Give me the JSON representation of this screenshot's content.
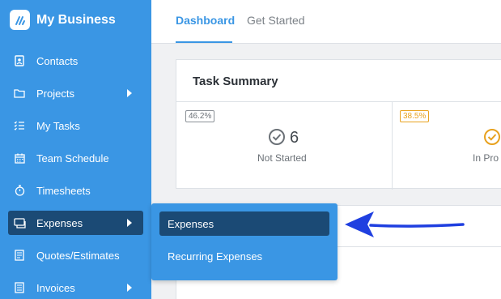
{
  "app": {
    "name": "My Business"
  },
  "sidebar": {
    "items": [
      {
        "label": "Contacts",
        "icon": "contacts-icon"
      },
      {
        "label": "Projects",
        "icon": "folder-icon",
        "has_submenu": true
      },
      {
        "label": "My Tasks",
        "icon": "tasks-icon"
      },
      {
        "label": "Team Schedule",
        "icon": "calendar-icon"
      },
      {
        "label": "Timesheets",
        "icon": "stopwatch-icon"
      },
      {
        "label": "Expenses",
        "icon": "expenses-icon",
        "has_submenu": true,
        "active": true
      },
      {
        "label": "Quotes/Estimates",
        "icon": "quotes-icon"
      },
      {
        "label": "Invoices",
        "icon": "invoice-icon",
        "has_submenu": true
      }
    ]
  },
  "header": {
    "tabs": [
      {
        "label": "Dashboard",
        "active": true
      },
      {
        "label": "Get Started",
        "active": false
      }
    ]
  },
  "task_summary": {
    "title": "Task Summary",
    "stats": [
      {
        "percent": "46.2%",
        "count": "6",
        "label": "Not Started",
        "color": "#8a9096"
      },
      {
        "percent": "38.5%",
        "count": "",
        "label": "In Pro",
        "color": "#e8a21f"
      }
    ]
  },
  "expenses_menu": {
    "items": [
      {
        "label": "Expenses",
        "active": true
      },
      {
        "label": "Recurring Expenses",
        "active": false
      }
    ]
  },
  "colors": {
    "sidebar": "#3a96e4",
    "active_item": "#1b4a75",
    "accent": "#3a96e4",
    "annotation_arrow": "#1f3fe0",
    "in_progress": "#e8a21f"
  }
}
